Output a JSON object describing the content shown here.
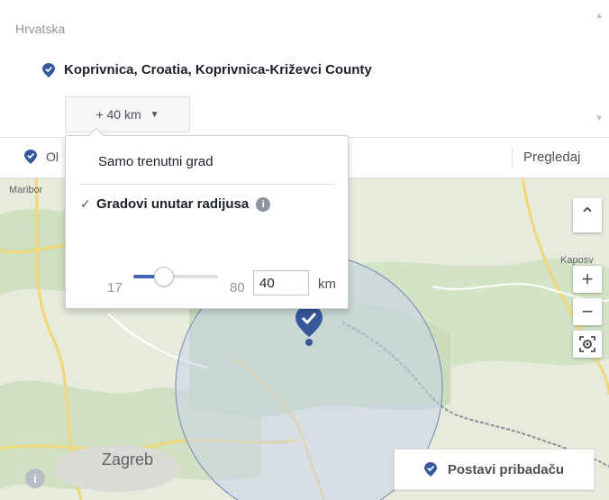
{
  "location_panel": {
    "country": "Hrvatska",
    "location_name": "Koprivnica, Croatia, Koprivnica-Križevci County",
    "radius_button_label": "+ 40 km",
    "caret_icon": "caret-down-icon",
    "scroll_up_icon": "▲",
    "scroll_down_icon": "▼"
  },
  "toolbar": {
    "location_text": "Ol",
    "browse_label": "Pregledaj"
  },
  "radius_dropdown": {
    "option_city_only": "Samo trenutni grad",
    "option_radius": "Gradovi unutar radijusa",
    "option_radius_checked": true,
    "check_icon": "✓",
    "info_icon": "i",
    "slider_min": "17",
    "slider_max": "80",
    "radius_value": "40",
    "slider_min_value": 17,
    "slider_max_value": 80,
    "slider_current_value": 40,
    "unit": "km"
  },
  "map": {
    "labels": {
      "maribor": "Maribor",
      "kaposvar": "Kaposv",
      "zagreb": "Zagreb"
    },
    "controls": {
      "collapse": "⌃",
      "zoom_in": "+",
      "zoom_out": "−"
    },
    "drop_pin_label": "Postavi pribadaču",
    "info_icon": "i"
  },
  "colors": {
    "accent_blue": "#4267b2",
    "pin_blue": "#365899",
    "radius_fill": "#c9d4ea",
    "radius_stroke": "#6f88b8"
  }
}
